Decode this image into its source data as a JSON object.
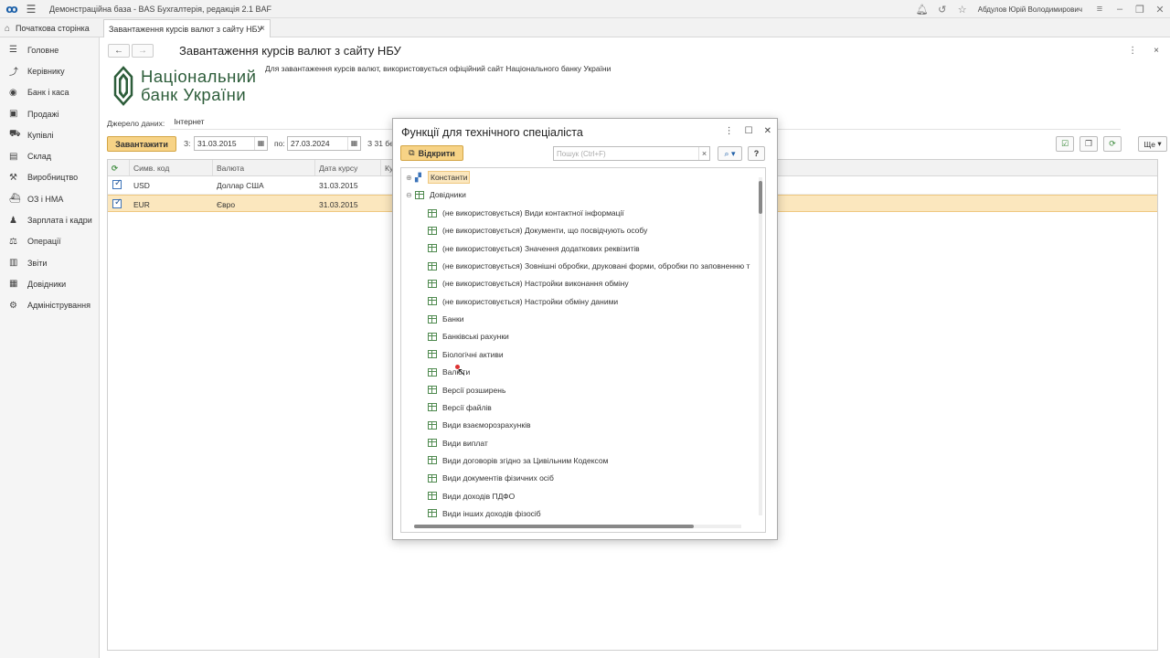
{
  "app": {
    "title": "Демонстраційна база - BAS Бухгалтерія, редакція 2.1 BAF",
    "user": "Абдулов Юрій Володимирович"
  },
  "tabs": {
    "home": "Початкова сторінка",
    "active": "Завантаження курсів валют з сайту НБУ"
  },
  "sidebar": {
    "items": [
      {
        "label": "Головне",
        "icon": "menu-lines-icon"
      },
      {
        "label": "Керівнику",
        "icon": "trend-icon"
      },
      {
        "label": "Банк і каса",
        "icon": "bank-icon"
      },
      {
        "label": "Продажі",
        "icon": "bag-icon"
      },
      {
        "label": "Купівлі",
        "icon": "cart-icon"
      },
      {
        "label": "Склад",
        "icon": "warehouse-icon"
      },
      {
        "label": "Виробництво",
        "icon": "factory-icon"
      },
      {
        "label": "ОЗ і НМА",
        "icon": "truck-icon"
      },
      {
        "label": "Зарплата і кадри",
        "icon": "person-icon"
      },
      {
        "label": "Операції",
        "icon": "operations-icon"
      },
      {
        "label": "Звіти",
        "icon": "chart-icon"
      },
      {
        "label": "Довідники",
        "icon": "book-icon"
      },
      {
        "label": "Адміністрування",
        "icon": "gear-icon"
      }
    ]
  },
  "form": {
    "title": "Завантаження курсів валют з сайту НБУ",
    "logo_line1": "Національний",
    "logo_line2": "банк України",
    "description": "Для завантаження курсів валют, використовується офіційний сайт Національного банку України",
    "source_label": "Джерело даних:",
    "source_value": "Інтернет",
    "load_button": "Завантажити",
    "from_label": "З:",
    "from_date": "31.03.2015",
    "to_label": "по:",
    "to_date": "27.03.2024",
    "period_text": "З 31 бе",
    "more_button": "Ще"
  },
  "table": {
    "headers": [
      "Симв. код",
      "Валюта",
      "Дата курсу",
      "Ку"
    ],
    "rows": [
      {
        "code": "USD",
        "currency": "Доллар США",
        "date": "31.03.2015",
        "checked": true
      },
      {
        "code": "EUR",
        "currency": "Євро",
        "date": "31.03.2015",
        "checked": true
      }
    ]
  },
  "modal": {
    "title": "Функції для технічного спеціаліста",
    "open_button": "Відкрити",
    "search_placeholder": "Пошук (Ctrl+F)",
    "help": "?",
    "tree": {
      "root1": "Константи",
      "root2": "Довідники",
      "items": [
        "(не використовується) Види контактної інформації",
        "(не використовується) Документи, що посвідчують особу",
        "(не використовується) Значення додаткових реквізитів",
        "(не використовується) Зовнішні обробки, друковані форми, обробки по заповненню т",
        "(не використовується) Настройки виконання обміну",
        "(не використовується) Настройки обміну даними",
        "Банки",
        "Банківські рахунки",
        "Біологічні активи",
        "Валюти",
        "Версії розширень",
        "Версії файлів",
        "Види взаєморозрахунків",
        "Види виплат",
        "Види договорів згідно за Цивільним Кодексом",
        "Види документів фізичних осіб",
        "Види доходів ПДФО",
        "Види інших доходів фізосіб"
      ]
    }
  },
  "colors": {
    "accent_button": "#f7d386",
    "selected_row": "#fbe7be",
    "nbu_green": "#2d5d3a"
  }
}
